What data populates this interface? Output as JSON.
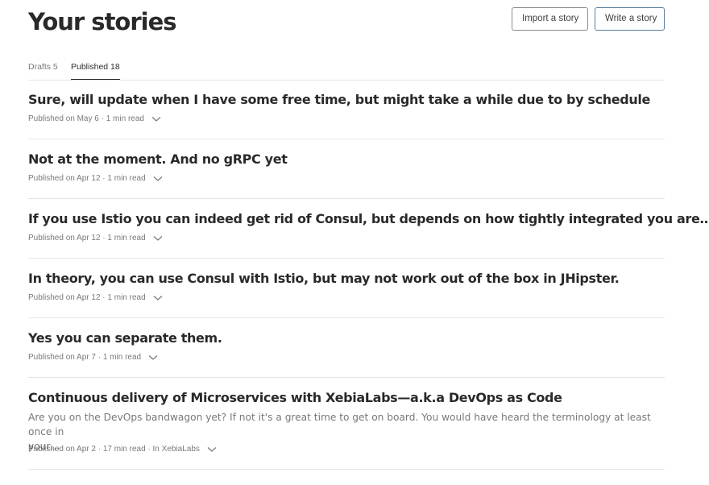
{
  "header": {
    "title": "Your stories",
    "import_label": "Import a story",
    "write_label": "Write a story"
  },
  "tabs": [
    {
      "label": "Drafts 5",
      "active": false
    },
    {
      "label": "Published 18",
      "active": true
    }
  ],
  "stories": [
    {
      "title": "Sure, will update when I have some free time, but might take a while due to by schedule",
      "meta": "Published on May 6 · 1 min read"
    },
    {
      "title": "Not at the moment. And no gRPC yet",
      "meta": "Published on Apr 12 · 1 min read"
    },
    {
      "title": "If you use Istio you can indeed get rid of Consul, but depends on how tightly integrated you are…",
      "meta": "Published on Apr 12 · 1 min read"
    },
    {
      "title": "In theory, you can use Consul with Istio, but may not work out of the box in JHipster.",
      "meta": "Published on Apr 12 · 1 min read"
    },
    {
      "title": "Yes you can separate them.",
      "meta": "Published on Apr 7 · 1 min read"
    },
    {
      "title": "Continuous delivery of Microservices with XebiaLabs—a.k.a DevOps as Code",
      "excerpt_line1": "Are you on the DevOps bandwagon yet? If not it's a great time to get on board. You would have heard the terminology at least once in",
      "excerpt_line2": "your…",
      "meta": "Published on Apr 2 · 17 min read · In XebiaLabs"
    }
  ],
  "icons": {
    "story_options": "chevron-down-icon"
  }
}
